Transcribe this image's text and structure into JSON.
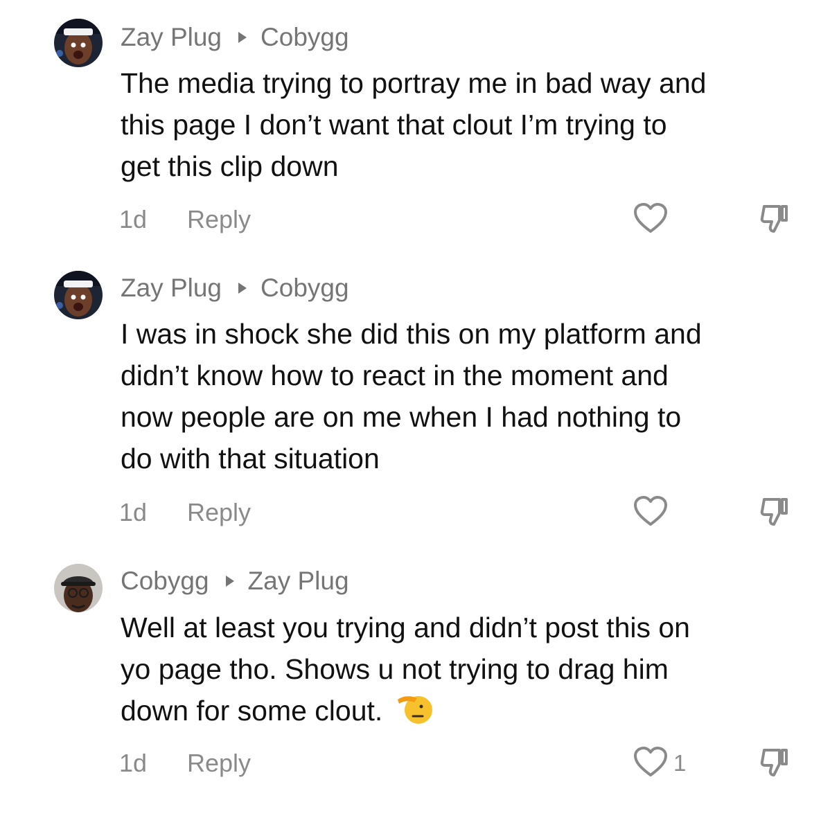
{
  "comments": [
    {
      "author": "Zay Plug",
      "reply_to": "Cobygg",
      "lines": [
        "The media trying to portray me in bad way and",
        "this page I don’t want that clout I’m trying to",
        "get this clip down"
      ],
      "time": "1d",
      "reply_label": "Reply",
      "like_count": ""
    },
    {
      "author": "Zay Plug",
      "reply_to": "Cobygg",
      "lines": [
        "I was in shock she did this on my platform and",
        "didn’t know how to react in the moment and",
        "now people are on me when I had nothing to",
        "do with that situation"
      ],
      "time": "1d",
      "reply_label": "Reply",
      "like_count": ""
    },
    {
      "author": "Cobygg",
      "reply_to": "Zay Plug",
      "lines": [
        "Well at least you trying and didn’t post this on",
        "yo page tho. Shows u not trying to drag him",
        "down for some clout."
      ],
      "emoji": "saluting-face",
      "time": "1d",
      "reply_label": "Reply",
      "like_count": "1"
    }
  ],
  "icons": {
    "like": "heart-outline-icon",
    "dislike": "thumbs-down-outline-icon",
    "separator": "caret-right-icon"
  },
  "colors": {
    "username": "#757575",
    "text": "#111111",
    "muted": "#8a8a8a",
    "background": "#ffffff"
  }
}
